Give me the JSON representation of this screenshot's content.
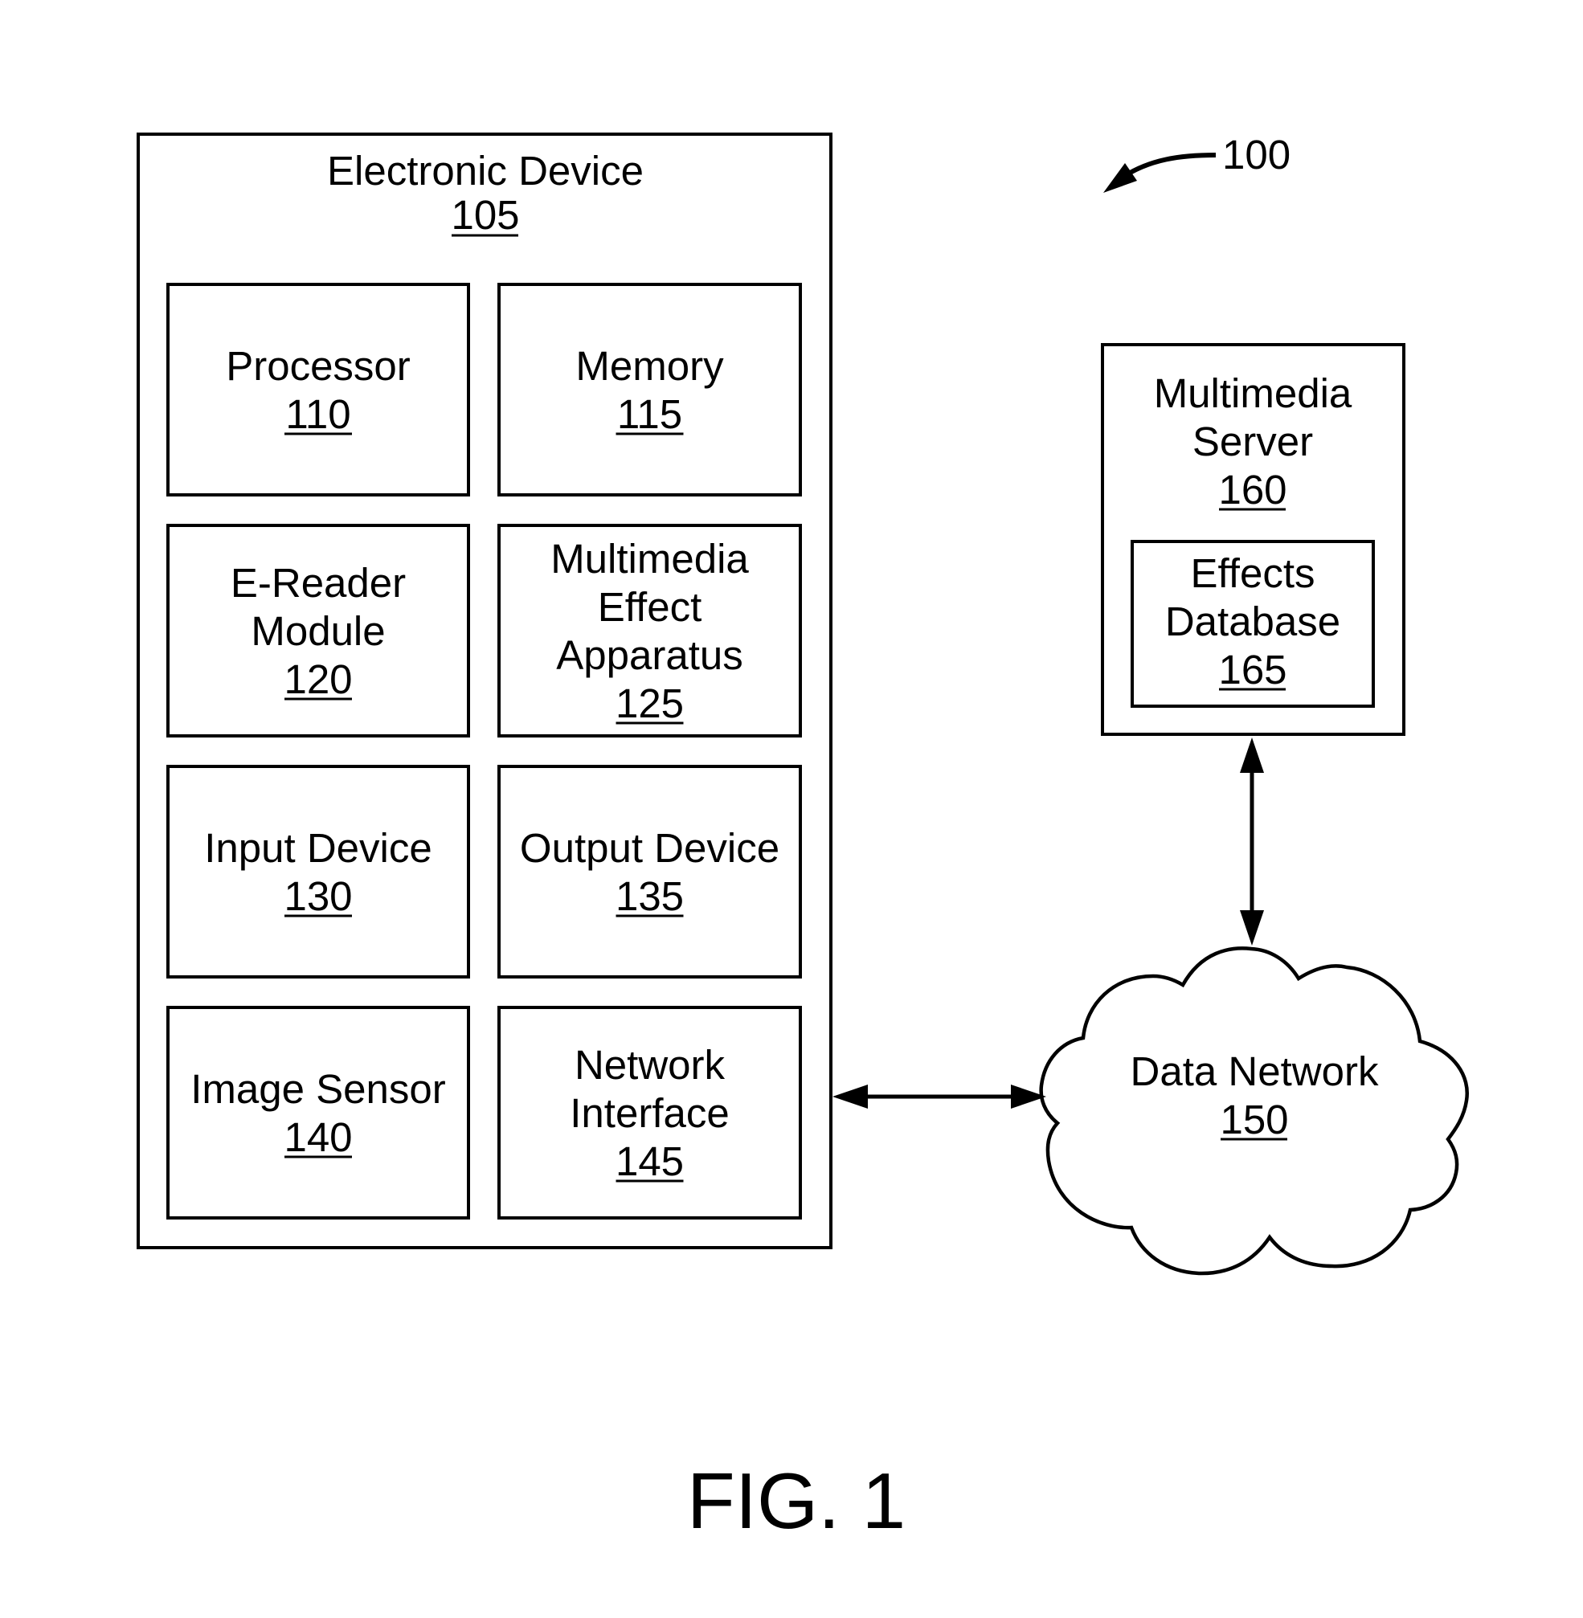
{
  "figure": {
    "caption": "FIG. 1",
    "system_ref": "100"
  },
  "electronic_device": {
    "title": "Electronic Device",
    "ref": "105",
    "components": [
      {
        "lines": [
          "Processor"
        ],
        "ref": "110"
      },
      {
        "lines": [
          "Memory"
        ],
        "ref": "115"
      },
      {
        "lines": [
          "E-Reader",
          "Module"
        ],
        "ref": "120"
      },
      {
        "lines": [
          "Multimedia",
          "Effect",
          "Apparatus"
        ],
        "ref": "125"
      },
      {
        "lines": [
          "Input Device"
        ],
        "ref": "130"
      },
      {
        "lines": [
          "Output Device"
        ],
        "ref": "135"
      },
      {
        "lines": [
          "Image Sensor"
        ],
        "ref": "140"
      },
      {
        "lines": [
          "Network",
          "Interface"
        ],
        "ref": "145"
      }
    ]
  },
  "data_network": {
    "lines": [
      "Data Network"
    ],
    "ref": "150"
  },
  "multimedia_server": {
    "lines": [
      "Multimedia",
      "Server"
    ],
    "ref": "160",
    "effects_database": {
      "lines": [
        "Effects",
        "Database"
      ],
      "ref": "165"
    }
  },
  "connections": [
    {
      "from": "Network Interface 145",
      "to": "Data Network 150",
      "direction": "bidirectional"
    },
    {
      "from": "Multimedia Server 160",
      "to": "Data Network 150",
      "direction": "bidirectional"
    }
  ]
}
